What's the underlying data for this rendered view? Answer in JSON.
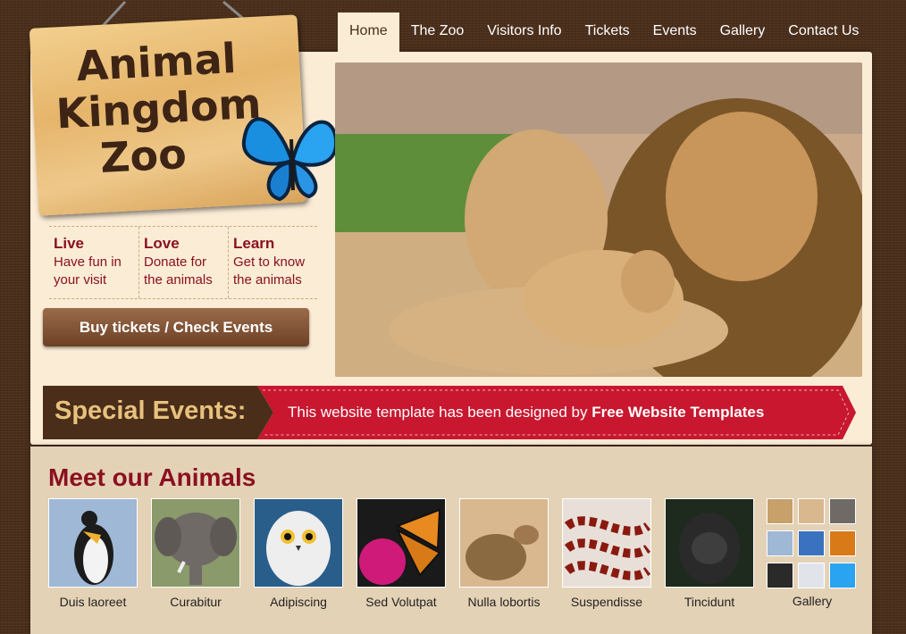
{
  "nav": {
    "items": [
      "Home",
      "The Zoo",
      "Visitors Info",
      "Tickets",
      "Events",
      "Gallery",
      "Contact Us"
    ]
  },
  "logo": {
    "line1": "Animal",
    "line2": "Kingdom",
    "line3": "Zoo"
  },
  "taglines": [
    {
      "title": "Live",
      "line1": "Have fun in",
      "line2": "your visit"
    },
    {
      "title": "Love",
      "line1": "Donate for",
      "line2": "the animals"
    },
    {
      "title": "Learn",
      "line1": "Get to know",
      "line2": "the animals"
    }
  ],
  "buy_button": "Buy tickets / Check Events",
  "events": {
    "label": "Special Events:",
    "text": "This website template has been designed by ",
    "link": "Free Website Templates"
  },
  "animals": {
    "heading": "Meet our Animals",
    "items": [
      "Duis laoreet",
      "Curabitur",
      "Adipiscing",
      "Sed Volutpat",
      "Nulla lobortis",
      "Suspendisse",
      "Tincidunt"
    ],
    "gallery_label": "Gallery"
  },
  "colors": {
    "accent": "#8a1020",
    "wood": "#4a2e1a",
    "banner": "#c8172f",
    "paper": "#fbecd6"
  }
}
